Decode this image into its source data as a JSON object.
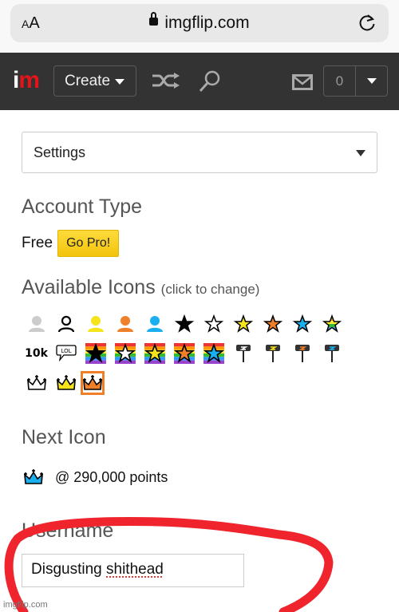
{
  "browser": {
    "text_size_label": "AA",
    "url": "imgflip.com",
    "lock_icon": "lock-icon",
    "reload_icon": "reload-icon"
  },
  "navbar": {
    "logo_i": "i",
    "logo_m": "m",
    "create_label": "Create",
    "notification_count": "0",
    "icons": [
      "shuffle-icon",
      "search-icon",
      "mail-icon",
      "chevron-down-icon"
    ]
  },
  "settings_select": {
    "value": "Settings"
  },
  "account_type": {
    "title": "Account Type",
    "value": "Free",
    "go_pro_label": "Go Pro!"
  },
  "available_icons": {
    "title": "Available Icons",
    "subtitle": "(click to change)",
    "rows": [
      [
        "user-gray",
        "user-outline",
        "user-yellow",
        "user-orange",
        "user-blue",
        "star-black",
        "star-white",
        "star-yellow",
        "star-orange",
        "star-blue",
        "star-rainbow"
      ],
      [
        "10k",
        "lol-bubble",
        "rainbow-star-black",
        "rainbow-star-white",
        "rainbow-star-yellow",
        "rainbow-star-orange",
        "rainbow-star-blue",
        "pin-white",
        "pin-yellow",
        "pin-orange",
        "pin-blue"
      ],
      [
        "crown-white",
        "crown-yellow",
        "crown-orange"
      ]
    ],
    "selected": "crown-orange",
    "colors": {
      "gray": "#cccccc",
      "yellow": "#f5e31c",
      "orange": "#f07f2a",
      "blue": "#1ab0f0",
      "selected_border": "#f07f2a"
    }
  },
  "next_icon": {
    "title": "Next Icon",
    "icon": "crown-blue",
    "points_text": "@ 290,000 points"
  },
  "username": {
    "title": "Username",
    "value": "Disgusting shithead",
    "first_word": "Disgusting",
    "second_word": "shithead"
  },
  "annotation": {
    "color": "#f0242c",
    "shape": "hand-drawn circle around username"
  },
  "watermark": "imgflip.com"
}
